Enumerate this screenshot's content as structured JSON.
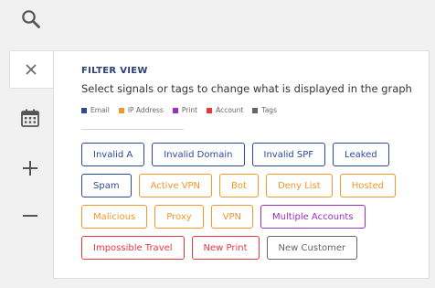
{
  "icons": {
    "search": "search-icon",
    "close": "close-icon",
    "calendar": "calendar-icon",
    "zoom_in": "plus-icon",
    "zoom_out": "minus-icon"
  },
  "colors": {
    "email": "#2c4a9c",
    "ip": "#f3962c",
    "print": "#9b2fbf",
    "account": "#e8383b",
    "tags": "#666666",
    "title": "#2c3e7a"
  },
  "panel": {
    "title": "FILTER VIEW",
    "description": "Select signals or tags to change what is displayed in the graph",
    "legend": [
      {
        "label": "Email",
        "color": "#2c4a9c"
      },
      {
        "label": "IP Address",
        "color": "#f3962c"
      },
      {
        "label": "Print",
        "color": "#9b2fbf"
      },
      {
        "label": "Account",
        "color": "#e8383b"
      },
      {
        "label": "Tags",
        "color": "#666666"
      }
    ],
    "chip_rows": [
      [
        {
          "label": "Invalid A",
          "category": "email"
        },
        {
          "label": "Invalid Domain",
          "category": "email"
        },
        {
          "label": "Invalid SPF",
          "category": "email"
        },
        {
          "label": "Leaked",
          "category": "email"
        }
      ],
      [
        {
          "label": "Spam",
          "category": "email"
        },
        {
          "label": "Active VPN",
          "category": "ip"
        },
        {
          "label": "Bot",
          "category": "ip"
        },
        {
          "label": "Deny List",
          "category": "ip"
        },
        {
          "label": "Hosted",
          "category": "ip"
        }
      ],
      [
        {
          "label": "Malicious",
          "category": "ip"
        },
        {
          "label": "Proxy",
          "category": "ip"
        },
        {
          "label": "VPN",
          "category": "ip"
        },
        {
          "label": "Multiple Accounts",
          "category": "print"
        }
      ],
      [
        {
          "label": "Impossible Travel",
          "category": "account"
        },
        {
          "label": "New Print",
          "category": "account"
        },
        {
          "label": "New Customer",
          "category": "tags"
        }
      ]
    ]
  }
}
